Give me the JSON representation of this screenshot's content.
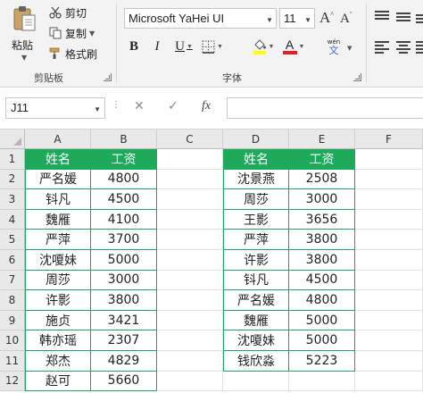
{
  "colors": {
    "accent_green": "#1daa5a",
    "ribbon_bg": "#f3f3f3"
  },
  "clipboard": {
    "paste_label": "粘贴",
    "cut_label": "剪切",
    "copy_label": "复制",
    "format_painter_label": "格式刷",
    "group_label": "剪贴板"
  },
  "font": {
    "name": "Microsoft YaHei UI",
    "size": "11",
    "group_label": "字体",
    "grow_label": "A",
    "shrink_label": "A",
    "bold_label": "B",
    "italic_label": "I",
    "underline_label": "U",
    "font_color_label": "A",
    "phonetic_top": "wén",
    "phonetic_bottom": "文"
  },
  "formula_bar": {
    "name_box": "J11",
    "cancel_symbol": "✕",
    "enter_symbol": "✓",
    "fx_label": "fx",
    "formula": ""
  },
  "columns": [
    "A",
    "B",
    "C",
    "D",
    "E",
    "F"
  ],
  "rows": [
    "1",
    "2",
    "3",
    "4",
    "5",
    "6",
    "7",
    "8",
    "9",
    "10",
    "11",
    "12"
  ],
  "table1": {
    "headers": [
      "姓名",
      "工资"
    ],
    "rows": [
      [
        "严名媛",
        "4800"
      ],
      [
        "钭凡",
        "4500"
      ],
      [
        "魏雁",
        "4100"
      ],
      [
        "严萍",
        "3700"
      ],
      [
        "沈嗄妹",
        "5000"
      ],
      [
        "周莎",
        "3000"
      ],
      [
        "许影",
        "3800"
      ],
      [
        "施贞",
        "3421"
      ],
      [
        "韩亦瑶",
        "2307"
      ],
      [
        "郑杰",
        "4829"
      ],
      [
        "赵可",
        "5660"
      ]
    ]
  },
  "table2": {
    "headers": [
      "姓名",
      "工资"
    ],
    "rows": [
      [
        "沈景燕",
        "2508"
      ],
      [
        "周莎",
        "3000"
      ],
      [
        "王影",
        "3656"
      ],
      [
        "严萍",
        "3800"
      ],
      [
        "许影",
        "3800"
      ],
      [
        "钭凡",
        "4500"
      ],
      [
        "严名媛",
        "4800"
      ],
      [
        "魏雁",
        "5000"
      ],
      [
        "沈嗄妹",
        "5000"
      ],
      [
        "钱欣淼",
        "5223"
      ]
    ]
  }
}
